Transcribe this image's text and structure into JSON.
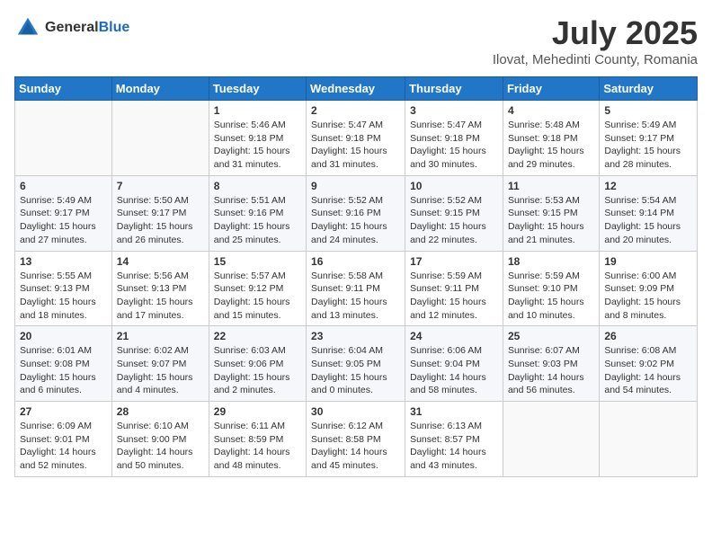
{
  "logo": {
    "general": "General",
    "blue": "Blue"
  },
  "title": {
    "month": "July 2025",
    "location": "Ilovat, Mehedinti County, Romania"
  },
  "headers": [
    "Sunday",
    "Monday",
    "Tuesday",
    "Wednesday",
    "Thursday",
    "Friday",
    "Saturday"
  ],
  "weeks": [
    [
      {
        "day": "",
        "info": ""
      },
      {
        "day": "",
        "info": ""
      },
      {
        "day": "1",
        "info": "Sunrise: 5:46 AM\nSunset: 9:18 PM\nDaylight: 15 hours\nand 31 minutes."
      },
      {
        "day": "2",
        "info": "Sunrise: 5:47 AM\nSunset: 9:18 PM\nDaylight: 15 hours\nand 31 minutes."
      },
      {
        "day": "3",
        "info": "Sunrise: 5:47 AM\nSunset: 9:18 PM\nDaylight: 15 hours\nand 30 minutes."
      },
      {
        "day": "4",
        "info": "Sunrise: 5:48 AM\nSunset: 9:18 PM\nDaylight: 15 hours\nand 29 minutes."
      },
      {
        "day": "5",
        "info": "Sunrise: 5:49 AM\nSunset: 9:17 PM\nDaylight: 15 hours\nand 28 minutes."
      }
    ],
    [
      {
        "day": "6",
        "info": "Sunrise: 5:49 AM\nSunset: 9:17 PM\nDaylight: 15 hours\nand 27 minutes."
      },
      {
        "day": "7",
        "info": "Sunrise: 5:50 AM\nSunset: 9:17 PM\nDaylight: 15 hours\nand 26 minutes."
      },
      {
        "day": "8",
        "info": "Sunrise: 5:51 AM\nSunset: 9:16 PM\nDaylight: 15 hours\nand 25 minutes."
      },
      {
        "day": "9",
        "info": "Sunrise: 5:52 AM\nSunset: 9:16 PM\nDaylight: 15 hours\nand 24 minutes."
      },
      {
        "day": "10",
        "info": "Sunrise: 5:52 AM\nSunset: 9:15 PM\nDaylight: 15 hours\nand 22 minutes."
      },
      {
        "day": "11",
        "info": "Sunrise: 5:53 AM\nSunset: 9:15 PM\nDaylight: 15 hours\nand 21 minutes."
      },
      {
        "day": "12",
        "info": "Sunrise: 5:54 AM\nSunset: 9:14 PM\nDaylight: 15 hours\nand 20 minutes."
      }
    ],
    [
      {
        "day": "13",
        "info": "Sunrise: 5:55 AM\nSunset: 9:13 PM\nDaylight: 15 hours\nand 18 minutes."
      },
      {
        "day": "14",
        "info": "Sunrise: 5:56 AM\nSunset: 9:13 PM\nDaylight: 15 hours\nand 17 minutes."
      },
      {
        "day": "15",
        "info": "Sunrise: 5:57 AM\nSunset: 9:12 PM\nDaylight: 15 hours\nand 15 minutes."
      },
      {
        "day": "16",
        "info": "Sunrise: 5:58 AM\nSunset: 9:11 PM\nDaylight: 15 hours\nand 13 minutes."
      },
      {
        "day": "17",
        "info": "Sunrise: 5:59 AM\nSunset: 9:11 PM\nDaylight: 15 hours\nand 12 minutes."
      },
      {
        "day": "18",
        "info": "Sunrise: 5:59 AM\nSunset: 9:10 PM\nDaylight: 15 hours\nand 10 minutes."
      },
      {
        "day": "19",
        "info": "Sunrise: 6:00 AM\nSunset: 9:09 PM\nDaylight: 15 hours\nand 8 minutes."
      }
    ],
    [
      {
        "day": "20",
        "info": "Sunrise: 6:01 AM\nSunset: 9:08 PM\nDaylight: 15 hours\nand 6 minutes."
      },
      {
        "day": "21",
        "info": "Sunrise: 6:02 AM\nSunset: 9:07 PM\nDaylight: 15 hours\nand 4 minutes."
      },
      {
        "day": "22",
        "info": "Sunrise: 6:03 AM\nSunset: 9:06 PM\nDaylight: 15 hours\nand 2 minutes."
      },
      {
        "day": "23",
        "info": "Sunrise: 6:04 AM\nSunset: 9:05 PM\nDaylight: 15 hours\nand 0 minutes."
      },
      {
        "day": "24",
        "info": "Sunrise: 6:06 AM\nSunset: 9:04 PM\nDaylight: 14 hours\nand 58 minutes."
      },
      {
        "day": "25",
        "info": "Sunrise: 6:07 AM\nSunset: 9:03 PM\nDaylight: 14 hours\nand 56 minutes."
      },
      {
        "day": "26",
        "info": "Sunrise: 6:08 AM\nSunset: 9:02 PM\nDaylight: 14 hours\nand 54 minutes."
      }
    ],
    [
      {
        "day": "27",
        "info": "Sunrise: 6:09 AM\nSunset: 9:01 PM\nDaylight: 14 hours\nand 52 minutes."
      },
      {
        "day": "28",
        "info": "Sunrise: 6:10 AM\nSunset: 9:00 PM\nDaylight: 14 hours\nand 50 minutes."
      },
      {
        "day": "29",
        "info": "Sunrise: 6:11 AM\nSunset: 8:59 PM\nDaylight: 14 hours\nand 48 minutes."
      },
      {
        "day": "30",
        "info": "Sunrise: 6:12 AM\nSunset: 8:58 PM\nDaylight: 14 hours\nand 45 minutes."
      },
      {
        "day": "31",
        "info": "Sunrise: 6:13 AM\nSunset: 8:57 PM\nDaylight: 14 hours\nand 43 minutes."
      },
      {
        "day": "",
        "info": ""
      },
      {
        "day": "",
        "info": ""
      }
    ]
  ]
}
